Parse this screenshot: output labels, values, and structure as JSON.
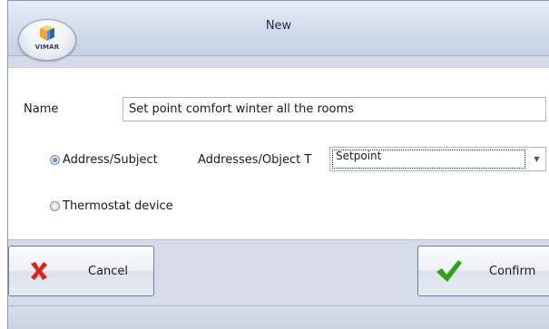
{
  "window": {
    "title": "New",
    "logo_text": "VIMAR"
  },
  "form": {
    "name_label": "Name",
    "name_value": "Set point comfort winter all the rooms",
    "radio_address_label": "Address/Subject",
    "radio_address_checked": true,
    "addresses_label": "Addresses/Object T",
    "addresses_value": "Setpoint",
    "radio_thermostat_label": "Thermostat device",
    "radio_thermostat_checked": false
  },
  "buttons": {
    "cancel_label": "Cancel",
    "confirm_label": "Confirm"
  },
  "colors": {
    "cancel_icon": "#e0201c",
    "confirm_icon": "#2fa31c",
    "radio_selected": "#1f5fae"
  }
}
